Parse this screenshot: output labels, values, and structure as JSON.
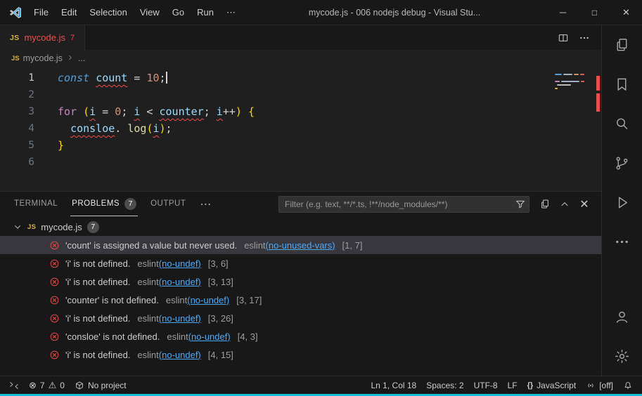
{
  "colors": {
    "error_red": "#f14c4c",
    "link_blue": "#4daafc",
    "brand_blue": "#27a3e0",
    "js_yellow": "#d9b23c",
    "accent_strip": "#17bdd3",
    "bracket_gold": "#ffd700"
  },
  "titlebar": {
    "menus": [
      "File",
      "Edit",
      "Selection",
      "View",
      "Go",
      "Run",
      "⋯"
    ],
    "title": "mycode.js - 006 nodejs debug - Visual Stu...",
    "controls": {
      "minimize": "─",
      "maximize": "□",
      "close": "✕"
    }
  },
  "tabbar": {
    "tab": {
      "icon": "JS",
      "name": "mycode.js",
      "badge": "7"
    }
  },
  "breadcrumb": {
    "icon": "JS",
    "file": "mycode.js",
    "more": "..."
  },
  "editor": {
    "lines": [
      {
        "num": "1",
        "active": true,
        "cursor": true,
        "tokens": [
          {
            "t": "const",
            "s": "kw"
          },
          {
            "t": " ",
            "s": "pl"
          },
          {
            "t": "count",
            "s": "vr err"
          },
          {
            "t": " = ",
            "s": "pl"
          },
          {
            "t": "10",
            "s": "num"
          },
          {
            "t": ";",
            "s": "pl"
          }
        ]
      },
      {
        "num": "2",
        "tokens": []
      },
      {
        "num": "3",
        "tokens": [
          {
            "t": "for",
            "s": "ctrl"
          },
          {
            "t": " ",
            "s": "pl"
          },
          {
            "t": "(",
            "s": "br"
          },
          {
            "t": "i",
            "s": "vr err"
          },
          {
            "t": " = ",
            "s": "pl"
          },
          {
            "t": "0",
            "s": "num"
          },
          {
            "t": "; ",
            "s": "pl"
          },
          {
            "t": "i",
            "s": "vr err"
          },
          {
            "t": " < ",
            "s": "pl"
          },
          {
            "t": "counter",
            "s": "vr err"
          },
          {
            "t": "; ",
            "s": "pl"
          },
          {
            "t": "i",
            "s": "vr err"
          },
          {
            "t": "++",
            "s": "pl"
          },
          {
            "t": ")",
            "s": "br"
          },
          {
            "t": " ",
            "s": "pl"
          },
          {
            "t": "{",
            "s": "br"
          }
        ]
      },
      {
        "num": "4",
        "tokens": [
          {
            "t": "  ",
            "s": "pl"
          },
          {
            "t": "consloe",
            "s": "vr err"
          },
          {
            "t": ". ",
            "s": "pl"
          },
          {
            "t": "log",
            "s": "fn"
          },
          {
            "t": "(",
            "s": "br"
          },
          {
            "t": "i",
            "s": "vr err"
          },
          {
            "t": ")",
            "s": "br"
          },
          {
            "t": ";",
            "s": "pl"
          }
        ]
      },
      {
        "num": "5",
        "tokens": [
          {
            "t": "}",
            "s": "br"
          }
        ]
      },
      {
        "num": "6",
        "tokens": []
      }
    ]
  },
  "panel": {
    "tabs": [
      {
        "label": "TERMINAL",
        "active": false
      },
      {
        "label": "PROBLEMS",
        "active": true,
        "badge": "7"
      },
      {
        "label": "OUTPUT",
        "active": false
      }
    ],
    "more": "⋯",
    "filter_placeholder": "Filter (e.g. text, **/*.ts, !**/node_modules/**)",
    "group": {
      "icon": "JS",
      "file": "mycode.js",
      "badge": "7"
    },
    "problems": [
      {
        "message": "'count' is assigned a value but never used.",
        "source": "eslint",
        "rule": "(no-unused-vars)",
        "pos": "[1, 7]",
        "selected": true
      },
      {
        "message": "'i' is not defined.",
        "source": "eslint",
        "rule": "(no-undef)",
        "pos": "[3, 6]",
        "selected": false
      },
      {
        "message": "'i' is not defined.",
        "source": "eslint",
        "rule": "(no-undef)",
        "pos": "[3, 13]",
        "selected": false
      },
      {
        "message": "'counter' is not defined.",
        "source": "eslint",
        "rule": "(no-undef)",
        "pos": "[3, 17]",
        "selected": false
      },
      {
        "message": "'i' is not defined.",
        "source": "eslint",
        "rule": "(no-undef)",
        "pos": "[3, 26]",
        "selected": false
      },
      {
        "message": "'consloe' is not defined.",
        "source": "eslint",
        "rule": "(no-undef)",
        "pos": "[4, 3]",
        "selected": false
      },
      {
        "message": "'i' is not defined.",
        "source": "eslint",
        "rule": "(no-undef)",
        "pos": "[4, 15]",
        "selected": false
      }
    ]
  },
  "statusbar": {
    "errors": "7",
    "warnings": "0",
    "project": "No project",
    "ln_col": "Ln 1, Col 18",
    "spaces": "Spaces: 2",
    "encoding": "UTF-8",
    "eol": "LF",
    "language": "JavaScript",
    "port_label": "[off]",
    "icons": {
      "errors": "⊗",
      "warnings": "⚠",
      "braces": "{}"
    }
  },
  "activity_bar": {
    "icons": [
      "files-icon",
      "bookmark-icon",
      "search-icon",
      "source-control-icon",
      "run-debug-icon",
      "more-icon",
      "account-icon",
      "settings-gear-icon"
    ]
  }
}
